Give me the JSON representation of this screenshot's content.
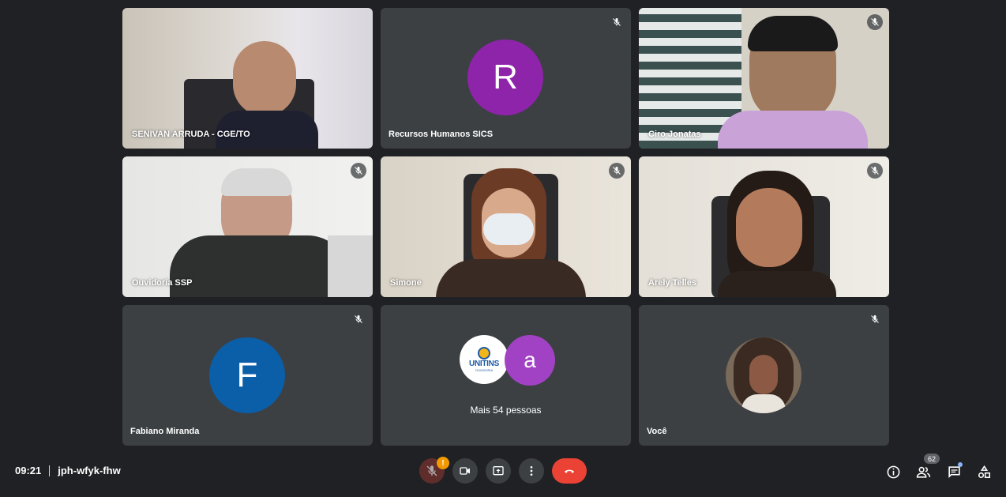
{
  "tiles": [
    {
      "name": "SENIVAN ARRUDA - CGE/TO",
      "muted": false,
      "type": "video"
    },
    {
      "name": "Recursos Humanos SICS",
      "muted": true,
      "type": "avatar",
      "initial": "R",
      "color": "#8e24aa"
    },
    {
      "name": "Ciro Jonatas",
      "muted": true,
      "type": "video"
    },
    {
      "name": "Ouvidoria SSP",
      "muted": true,
      "type": "video"
    },
    {
      "name": "Simone",
      "muted": true,
      "type": "video"
    },
    {
      "name": "Arely Telles",
      "muted": true,
      "type": "video"
    },
    {
      "name": "Fabiano Miranda",
      "muted": true,
      "type": "avatar",
      "initial": "F",
      "color": "#0b5ea8"
    },
    {
      "name": "Mais 54 pessoas",
      "type": "overflow",
      "logo_text": "UNITINS",
      "logo_sub": "OUVIDORIA",
      "second_initial": "a",
      "second_color": "#a142c4"
    },
    {
      "name": "Você",
      "muted": true,
      "type": "self"
    }
  ],
  "meeting": {
    "time": "09:21",
    "code": "jph-wfyk-fhw"
  },
  "controls": {
    "mic_warning": "!",
    "participants_count": "62"
  },
  "icons": [
    "mic-off-icon",
    "camera-icon",
    "present-icon",
    "more-options-icon",
    "end-call-icon",
    "info-icon",
    "people-icon",
    "chat-icon",
    "activities-icon"
  ]
}
